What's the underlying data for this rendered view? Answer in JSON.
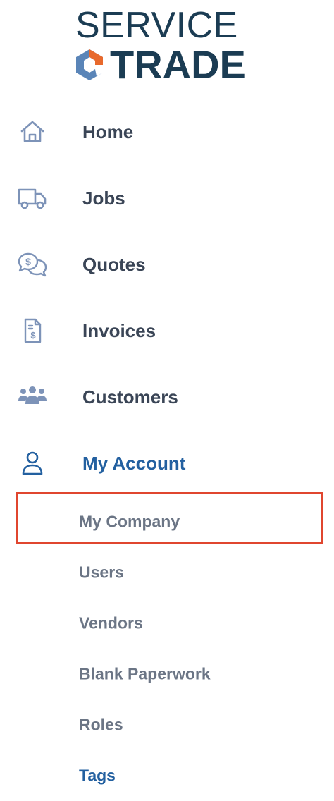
{
  "logo": {
    "line1": "SERVICE",
    "line2": "TRADE",
    "brand_dark": "#1b3c53",
    "brand_orange": "#e8692c",
    "brand_blue": "#5a85b8"
  },
  "nav": {
    "items": [
      {
        "label": "Home",
        "icon": "home-icon"
      },
      {
        "label": "Jobs",
        "icon": "truck-icon"
      },
      {
        "label": "Quotes",
        "icon": "quote-chat-icon"
      },
      {
        "label": "Invoices",
        "icon": "invoice-icon"
      },
      {
        "label": "Customers",
        "icon": "customers-icon"
      },
      {
        "label": "My Account",
        "icon": "user-icon",
        "active": true
      }
    ],
    "sub_items": [
      {
        "label": "My Company",
        "highlighted": true
      },
      {
        "label": "Users"
      },
      {
        "label": "Vendors"
      },
      {
        "label": "Blank Paperwork"
      },
      {
        "label": "Roles"
      },
      {
        "label": "Tags",
        "current": true
      }
    ]
  },
  "colors": {
    "nav_text": "#3a4556",
    "active_text": "#2360a0",
    "sub_text": "#6b7585",
    "icon_color": "#7d93b8",
    "highlight_border": "#e0462f"
  }
}
